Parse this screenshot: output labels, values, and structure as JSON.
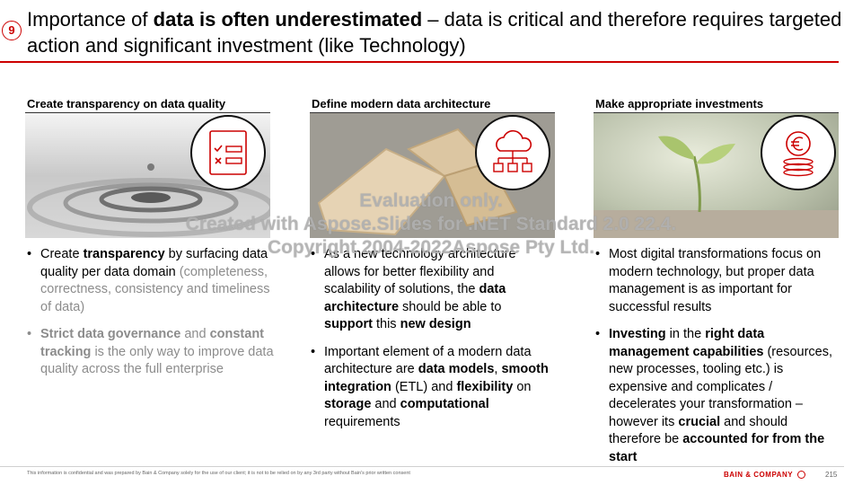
{
  "slide": {
    "number_badge": "9",
    "title": {
      "part1": "Importance of ",
      "bold": "data is often underestimated",
      "part2": " – data is critical and therefore requires targeted action and significant investment (like Technology)"
    }
  },
  "columns": [
    {
      "heading": "Create transparency on data quality",
      "icon": "checklist-icon",
      "bullets": [
        {
          "t1": "Create ",
          "b1": "transparency",
          "t2": " by surfacing data quality per data domain ",
          "g1": "(completeness, correctness, consistency and timeliness of data)"
        },
        {
          "b1": "Strict data governance",
          "t1": " and ",
          "b2": "constant tracking",
          "t2": " is the only way to improve data quality across the full enterprise"
        }
      ]
    },
    {
      "heading": "Define modern data architecture",
      "icon": "cloud-network-icon",
      "bullets": [
        {
          "t1": "As a new technology architecture allows for better flexibility and scalability of solutions, the ",
          "b1": "data architecture",
          "t2": " should be able to ",
          "b2": "support",
          "t3": " this ",
          "b3": "new design"
        },
        {
          "t1": "Important element of a modern data architecture are ",
          "b1": "data models",
          "t2": ", ",
          "b2": "smooth integration",
          "t3": " (ETL) and ",
          "b3": "flexibility",
          "t4": " on ",
          "b4": "storage",
          "t5": " and ",
          "b5": "computational",
          "t6": " requirements"
        }
      ]
    },
    {
      "heading": "Make appropriate investments",
      "icon": "euro-coins-icon",
      "bullets": [
        {
          "t1": "Most digital transformations focus on modern technology, but proper data management is as important for successful results"
        },
        {
          "b1": "Investing",
          "t1": " in the ",
          "b2": "right data management capabilities",
          "t2": " (resources, new processes, tooling etc.) is expensive and complicates / decelerates your transformation – however its ",
          "b3": "crucial",
          "t3": " and should therefore be ",
          "b4": "accounted for from the start"
        }
      ]
    }
  ],
  "watermark": {
    "line1": "Evaluation only.",
    "line2": "Created with Aspose.Slides for .NET Standard 2.0 22.4.",
    "line3": "Copyright 2004-2022Aspose Pty Ltd."
  },
  "footer": {
    "note": "This information is confidential and was prepared by Bain & Company solely for the use of our client; it is not to be relied on by any 3rd party without Bain's prior written consent",
    "brand": "BAIN & COMPANY",
    "page": "215"
  },
  "colors": {
    "accent": "#cc0000"
  }
}
